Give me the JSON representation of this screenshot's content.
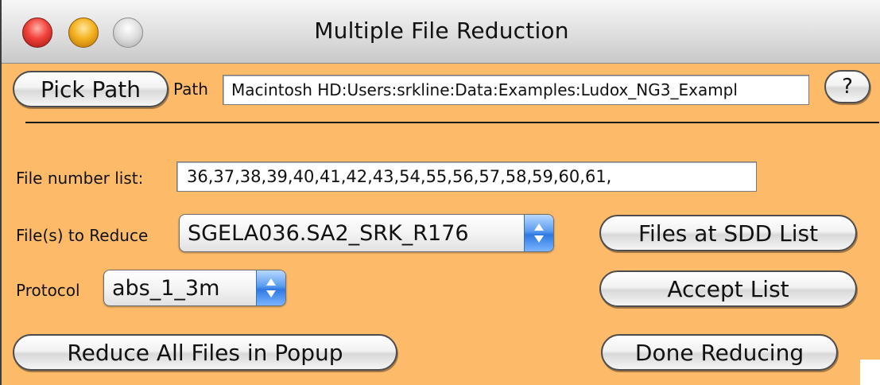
{
  "window": {
    "title": "Multiple File Reduction",
    "background_color": "#fdbb6a"
  },
  "toolbar": {
    "pick_path_label": "Pick Path",
    "path_label": "Path",
    "path_value": "Macintosh HD:Users:srkline:Data:Examples:Ludox_NG3_Exampl",
    "help_label": "?"
  },
  "form": {
    "file_number_list_label": "File number list:",
    "file_number_list_value": "36,37,38,39,40,41,42,43,54,55,56,57,58,59,60,61,",
    "files_to_reduce_label": "File(s) to Reduce",
    "files_to_reduce_selected": "SGELA036.SA2_SRK_R176",
    "protocol_label": "Protocol",
    "protocol_selected": "abs_1_3m"
  },
  "buttons": {
    "files_at_sdd_list": "Files at SDD List",
    "accept_list": "Accept List",
    "reduce_all": "Reduce All Files in Popup",
    "done_reducing": "Done Reducing"
  },
  "icons": {
    "close": "close-icon",
    "minimize": "minimize-icon",
    "zoom": "zoom-icon",
    "popup_arrows": "updown-arrows-icon"
  }
}
